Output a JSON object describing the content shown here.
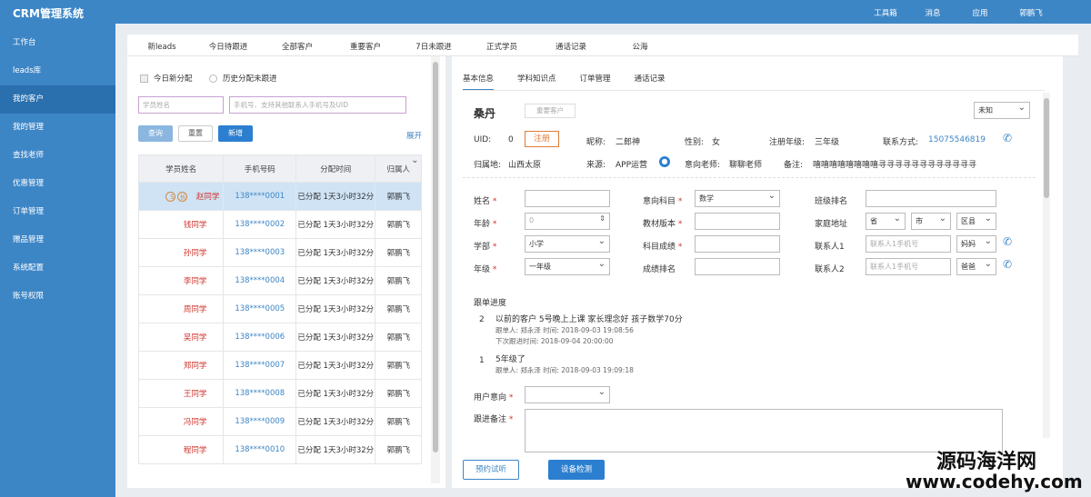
{
  "app": {
    "title": "CRM管理系统"
  },
  "topnav": [
    "工具箱",
    "消息",
    "应用",
    "郭鹏飞"
  ],
  "sidebar": [
    "工作台",
    "leads库",
    "我的客户",
    "我的管理",
    "查找老师",
    "优惠管理",
    "订单管理",
    "赠品管理",
    "系统配置",
    "账号权限"
  ],
  "tabs": [
    "新leads",
    "今日待跟进",
    "全部客户",
    "重要客户",
    "7日未跟进",
    "正式学员",
    "通话记录",
    "公海"
  ],
  "filters": {
    "today_new": "今日新分配",
    "history_unfollowed": "历史分配未跟进"
  },
  "search": {
    "name_placeholder": "学员姓名",
    "phone_placeholder": "手机号、支持其他联系人手机号及UID"
  },
  "buttons": {
    "query": "查询",
    "reset": "重置",
    "add": "新增",
    "expand": "展开"
  },
  "table": {
    "headers": [
      "学员姓名",
      "手机号码",
      "分配时间",
      "归属人"
    ],
    "badges": [
      "S",
      "长"
    ],
    "rows": [
      {
        "name": "赵同学",
        "phone": "138****0001",
        "time": "已分配 1天3小时32分",
        "owner": "郭鹏飞"
      },
      {
        "name": "钱同学",
        "phone": "138****0002",
        "time": "已分配 1天3小时32分",
        "owner": "郭鹏飞"
      },
      {
        "name": "孙同学",
        "phone": "138****0003",
        "time": "已分配 1天3小时32分",
        "owner": "郭鹏飞"
      },
      {
        "name": "李同学",
        "phone": "138****0004",
        "time": "已分配 1天3小时32分",
        "owner": "郭鹏飞"
      },
      {
        "name": "周同学",
        "phone": "138****0005",
        "time": "已分配 1天3小时32分",
        "owner": "郭鹏飞"
      },
      {
        "name": "吴同学",
        "phone": "138****0006",
        "time": "已分配 1天3小时32分",
        "owner": "郭鹏飞"
      },
      {
        "name": "郑同学",
        "phone": "138****0007",
        "time": "已分配 1天3小时32分",
        "owner": "郭鹏飞"
      },
      {
        "name": "王同学",
        "phone": "138****0008",
        "time": "已分配 1天3小时32分",
        "owner": "郭鹏飞"
      },
      {
        "name": "冯同学",
        "phone": "138****0009",
        "time": "已分配 1天3小时32分",
        "owner": "郭鹏飞"
      },
      {
        "name": "程同学",
        "phone": "138****0010",
        "time": "已分配 1天3小时32分",
        "owner": "郭鹏飞"
      }
    ]
  },
  "detail": {
    "tabs": [
      "基本信息",
      "学科知识点",
      "订单管理",
      "通话记录"
    ],
    "name": "桑丹",
    "reassign": "重要客户",
    "status_select": "未知",
    "uid_label": "UID:",
    "uid": "0",
    "register": "注册",
    "nickname_label": "昵称:",
    "nickname": "二郎神",
    "gender_label": "性别:",
    "gender": "女",
    "grade_label": "注册年级:",
    "grade": "三年级",
    "contact_label": "联系方式:",
    "contact": "15075546819",
    "region_label": "归属地:",
    "region": "山西太原",
    "source_label": "来源:",
    "source": "APP运营",
    "teacher_label": "意向老师:",
    "teacher": "聊聊老师",
    "remark_label": "备注:",
    "remark": "嘻嘻嘻嘻嘻嘻嘻嘻寻寻寻寻寻寻寻寻寻寻寻寻",
    "form": {
      "name_label": "姓名",
      "subject_label": "意向科目",
      "subject": "数学",
      "class_label": "班级排名",
      "age_label": "年龄",
      "age_value": "0",
      "textbook_label": "教材版本",
      "address_label": "家庭地址",
      "province": "省",
      "city": "市",
      "district": "区县",
      "school_label": "学部",
      "school": "小学",
      "score_label": "科目成绩",
      "contact1_label": "联系人1",
      "contact1_placeholder": "联系人1手机号",
      "contact1_rel": "妈妈",
      "year_label": "年级",
      "year": "一年级",
      "rank_label": "成绩排名",
      "contact2_label": "联系人2",
      "contact2_placeholder": "联系人1手机号",
      "contact2_rel": "爸爸"
    },
    "progress_title": "跟单进度",
    "progress": [
      {
        "num": "2",
        "text": "以前的客户 5号晚上上课 家长理念好 孩子数学70分",
        "meta": "跟单人: 郑永泽 时间: 2018-09-03 19:08:56",
        "next": "下次跟进时间: 2018-09-04  20:00:00"
      },
      {
        "num": "1",
        "text": "5年级了",
        "meta": "跟单人: 郑永泽 时间: 2018-09-03 19:09:18",
        "next": ""
      }
    ],
    "intent_label": "用户意向",
    "note_label": "跟进备注",
    "trial_button": "预约试听",
    "device_button": "设备检测"
  },
  "watermark": {
    "line1": "源码海洋网",
    "line2": "www.codehy.com"
  }
}
